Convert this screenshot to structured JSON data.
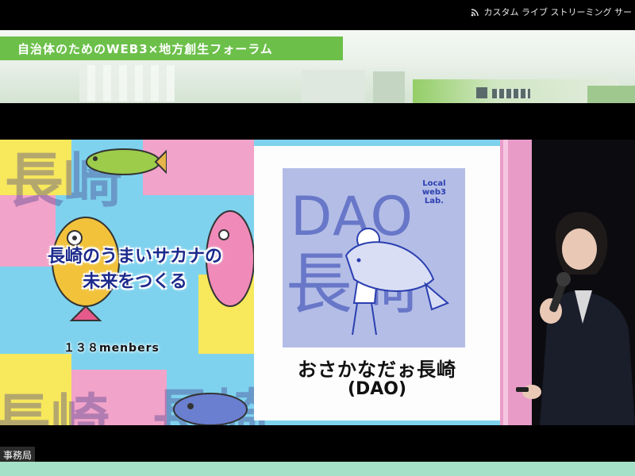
{
  "header": {
    "stream_label": "カスタム ライブ ストリーミング サー"
  },
  "banner": {
    "title": "自治体のためのWEB3×地方創生フォーラム"
  },
  "slide": {
    "left_title_line1": "長崎のうまいサカナの",
    "left_title_line2": "未来をつくる",
    "members": "１３８menbers",
    "logo_lab_line1": "Local",
    "logo_lab_line2": "web3",
    "logo_lab_line3": "Lab.",
    "logo_dao": "DAO",
    "logo_naga": "長崎",
    "org_name": "おさかなだぉ長崎",
    "org_type": "(DAO)",
    "bg_char": "長崎"
  },
  "footer": {
    "caption": "事務局"
  },
  "colors": {
    "banner_green": "#6cc04a",
    "slide_blue": "#7ed2ee",
    "logo_lavender": "#b4bde6",
    "footer_green": "#a5e0c8"
  }
}
